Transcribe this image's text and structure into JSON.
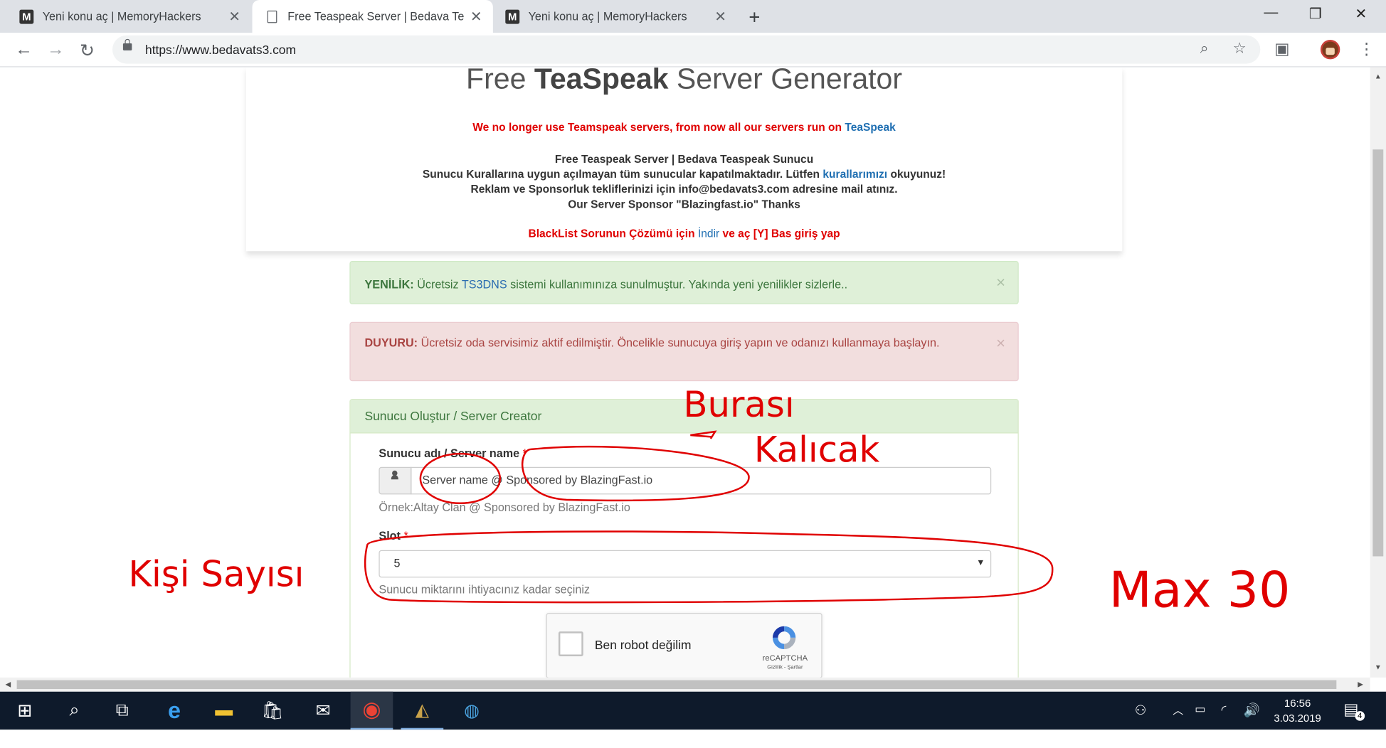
{
  "browser": {
    "tabs": [
      {
        "title": "Yeni konu aç | MemoryHackers",
        "favicon": "memoryhackers-icon",
        "active": false
      },
      {
        "title": "Free Teaspeak Server | Bedava Te",
        "favicon": "document-icon",
        "active": true
      },
      {
        "title": "Yeni konu aç | MemoryHackers",
        "favicon": "memoryhackers-icon",
        "active": false
      }
    ],
    "new_tab": "+",
    "url": "https://www.bedavats3.com"
  },
  "page": {
    "title_pre": "Free",
    "title_bold": "TeaSpeak",
    "title_post": "Server Generator",
    "notice_text": "We no longer use Teamspeak servers, from now all our servers run on",
    "notice_link": "TeaSpeak",
    "info_line1": "Free Teaspeak Server | Bedava Teaspeak Sunucu",
    "info_line2_pre": "Sunucu Kurallarına uygun açılmayan tüm sunucular kapatılmaktadır. Lütfen",
    "info_line2_link": "kurallarımızı",
    "info_line2_post": "okuyunuz!",
    "info_line3": "Reklam ve Sponsorluk tekliflerinizi için info@bedavats3.com adresine mail atınız.",
    "info_line4": "Our Server Sponsor \"Blazingfast.io\" Thanks",
    "blacklist_pre": "BlackList Sorunun Çözümü için",
    "blacklist_link": "İndir",
    "blacklist_post": "ve aç [Y] Bas giriş yap",
    "alert_success": {
      "label": "YENİLİK:",
      "text_pre": "Ücretsiz",
      "link": "TS3DNS",
      "text_post": "sistemi kullanımınıza sunulmuştur. Yakında yeni yenilikler sizlerle..",
      "close": "×"
    },
    "alert_danger": {
      "label": "DUYURU:",
      "text": "Ücretsiz oda servisimiz aktif edilmiştir. Öncelikle sunucuya giriş yapın ve odanızı kullanmaya başlayın.",
      "close": "×"
    },
    "panel": {
      "heading": "Sunucu Oluştur / Server Creator",
      "server_name_label": "Sunucu adı / Server name",
      "required_mark": "*",
      "server_name_value": "Server name @ Sponsored by BlazingFast.io",
      "server_name_help": "Örnek:Altay Clan @ Sponsored by BlazingFast.io",
      "slot_label": "Slot",
      "slot_value": "5",
      "slot_help": "Sunucu miktarını ihtiyacınız kadar seçiniz",
      "captcha_text": "Ben robot değilim",
      "captcha_brand": "reCAPTCHA",
      "captcha_terms": "Gizlilik - Şartlar"
    }
  },
  "annotations": {
    "line1": "Burası",
    "line2": "Kalıcak",
    "left": "Kişi Sayısı",
    "right": "Max 30",
    "color": "#e00000"
  },
  "taskbar": {
    "time": "16:56",
    "date": "3.03.2019",
    "notifications": "4"
  },
  "colors": {
    "notice_red": "#e00000",
    "link_blue": "#1f6fb2",
    "success_bg": "#dff0d8",
    "danger_bg": "#f2dede"
  }
}
